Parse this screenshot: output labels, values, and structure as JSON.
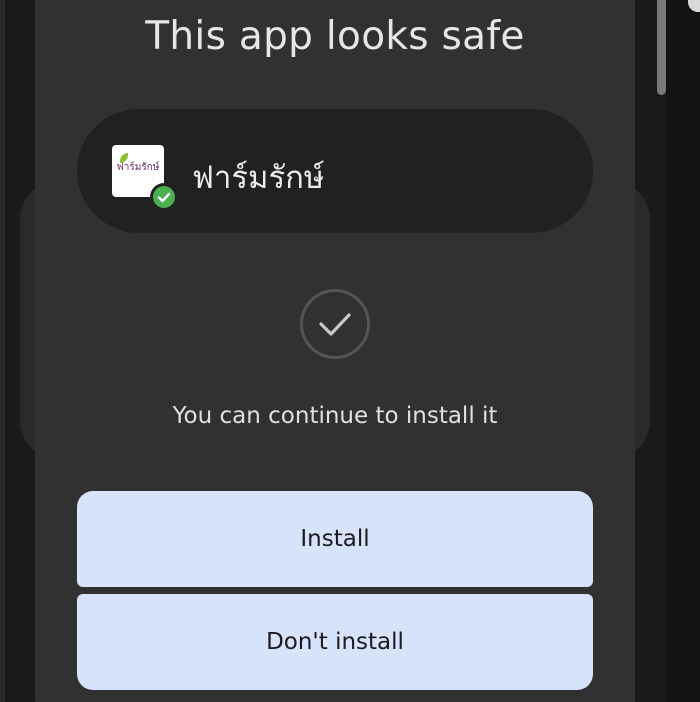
{
  "dialog": {
    "title": "This app looks safe",
    "app": {
      "name": "ฟาร์มรักษ์",
      "icon_text": "ฟาร์มรักษ์",
      "verified_icon": "check-badge-icon"
    },
    "status_icon": "check-circle-icon",
    "message": "You can continue to install it",
    "buttons": {
      "install_label": "Install",
      "dont_install_label": "Don't install"
    }
  },
  "colors": {
    "dialog_bg": "#313132",
    "chip_bg": "#212122",
    "button_bg": "#d6e3fb",
    "verified_green": "#4caf50"
  }
}
